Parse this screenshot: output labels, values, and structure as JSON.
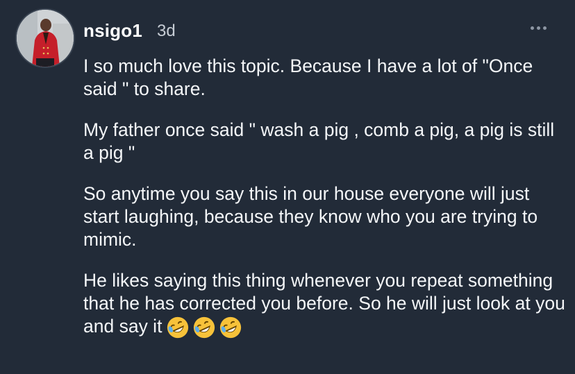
{
  "comment": {
    "username": "nsigo1",
    "time": "3d",
    "paragraphs": [
      "I so much love this topic. Because I have a lot of \"Once said \" to share.",
      "My father once said \" wash a pig , comb a pig, a pig is still a pig \"",
      "So anytime you say this in our house everyone will just start laughing, because they know who you are trying to mimic.",
      "He likes saying this thing whenever you repeat something that he has corrected you before. So he will just look at you and say it"
    ],
    "emojis": [
      "rolling-on-floor-laughing-emoji",
      "rolling-on-floor-laughing-emoji",
      "rolling-on-floor-laughing-emoji"
    ]
  },
  "colors": {
    "background": "#222b38",
    "text": "#f4f6f8",
    "muted": "#c7cdd5"
  }
}
